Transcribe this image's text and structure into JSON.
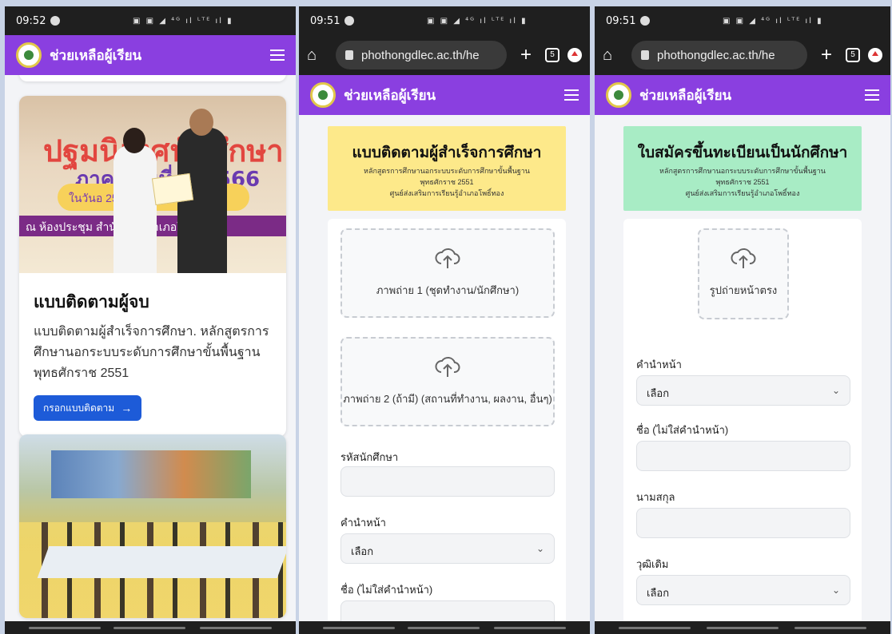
{
  "statusbars": [
    {
      "time": "09:52"
    },
    {
      "time": "09:51"
    },
    {
      "time": "09:51"
    }
  ],
  "status_icons": "▣ ▣ ◢ ⁴ᴳ ıl ᴸᵀᴱ ıl ▮",
  "browser": {
    "url": "phothongdlec.ac.th/he",
    "tab_count": "5"
  },
  "app": {
    "title": "ช่วยเหลือผู้เรียน"
  },
  "screen1": {
    "photo1_heading": "ปฐมนิเทศนักศึกษา",
    "photo1_line2": "ภาคเรียนที่ 1/2566",
    "photo1_ribbon": "ในวันอ                     2566",
    "photo1_strip": "ณ ห้องประชุม   สำนักงาน   อำเภอโพธิ์ทอง",
    "card_title": "แบบติดตามผู้จบ",
    "card_desc": "แบบติดตามผู้สำเร็จการศึกษา. หลักสูตรการศึกษานอกระบบระดับการศึกษาขั้นพื้นฐาน พุทธศักราช 2551",
    "button_label": "กรอกแบบติดตาม"
  },
  "screen2": {
    "form_title": "แบบติดตามผู้สำเร็จการศึกษา",
    "sub1": "หลักสูตรการศึกษานอกระบบระดับการศึกษาขั้นพื้นฐาน",
    "sub2": "พุทธศักราช 2551",
    "sub3": "ศูนย์ส่งเสริมการเรียนรู้อำเภอโพธิ์ทอง",
    "upload1": "ภาพถ่าย 1 (ชุดทำงาน/นักศึกษา)",
    "upload2": "ภาพถ่าย 2 (ถ้ามี) (สถานที่ทำงาน, ผลงาน, อื่นๆ)",
    "label_student_id": "รหัสนักศึกษา",
    "label_prefix": "คำนำหน้า",
    "select_prefix": "เลือก",
    "label_name": "ชื่อ (ไม่ใส่คำนำหน้า)"
  },
  "screen3": {
    "form_title": "ใบสมัครขึ้นทะเบียนเป็นนักศึกษา",
    "sub1": "หลักสูตรการศึกษานอกระบบระดับการศึกษาขั้นพื้นฐาน",
    "sub2": "พุทธศักราช 2551",
    "sub3": "ศูนย์ส่งเสริมการเรียนรู้อำเภอโพธิ์ทอง",
    "upload_photo": "รูปถ่ายหน้าตรง",
    "label_prefix": "คำนำหน้า",
    "select_prefix": "เลือก",
    "label_name": "ชื่อ (ไม่ใส่คำนำหน้า)",
    "label_surname": "นามสกุล",
    "label_education": "วุฒิเดิม",
    "select_education": "เลือก"
  },
  "colors": {
    "appbar": "#8a3fe0",
    "header_yellow": "#fde98a",
    "header_green": "#a8ecc5",
    "button": "#1d5bd8"
  }
}
